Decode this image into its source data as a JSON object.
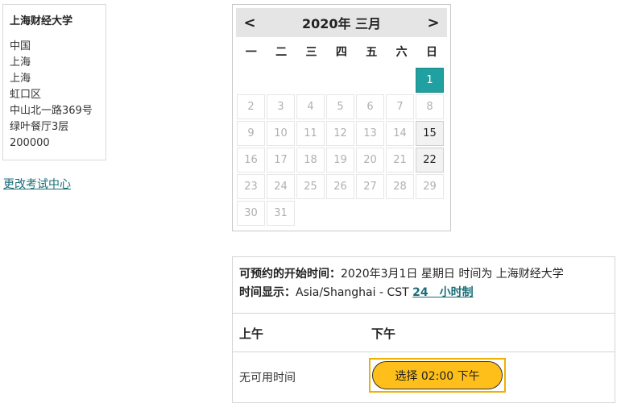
{
  "address": {
    "name": "上海财经大学",
    "lines": [
      "中国",
      "上海",
      "上海",
      "虹口区",
      "中山北一路369号",
      "绿叶餐厅3层",
      "200000"
    ]
  },
  "change_link": "更改考试中心",
  "calendar": {
    "prev": "<",
    "next": ">",
    "title": "2020年 三月",
    "weekdays": [
      "一",
      "二",
      "三",
      "四",
      "五",
      "六",
      "日"
    ],
    "weeks": [
      [
        {
          "d": ""
        },
        {
          "d": ""
        },
        {
          "d": ""
        },
        {
          "d": ""
        },
        {
          "d": ""
        },
        {
          "d": ""
        },
        {
          "d": "1",
          "s": "selected"
        }
      ],
      [
        {
          "d": "2"
        },
        {
          "d": "3"
        },
        {
          "d": "4"
        },
        {
          "d": "5"
        },
        {
          "d": "6"
        },
        {
          "d": "7"
        },
        {
          "d": "8"
        }
      ],
      [
        {
          "d": "9"
        },
        {
          "d": "10"
        },
        {
          "d": "11"
        },
        {
          "d": "12"
        },
        {
          "d": "13"
        },
        {
          "d": "14"
        },
        {
          "d": "15",
          "s": "available"
        }
      ],
      [
        {
          "d": "16"
        },
        {
          "d": "17"
        },
        {
          "d": "18"
        },
        {
          "d": "19"
        },
        {
          "d": "20"
        },
        {
          "d": "21"
        },
        {
          "d": "22",
          "s": "available"
        }
      ],
      [
        {
          "d": "23"
        },
        {
          "d": "24"
        },
        {
          "d": "25"
        },
        {
          "d": "26"
        },
        {
          "d": "27"
        },
        {
          "d": "28"
        },
        {
          "d": "29"
        }
      ],
      [
        {
          "d": "30"
        },
        {
          "d": "31"
        }
      ]
    ]
  },
  "booking": {
    "start_label": "可预约的开始时间：",
    "start_value": "2020年3月1日 星期日 时间为 上海财经大学",
    "tz_label": "时间显示：",
    "tz_value": "Asia/Shanghai - CST",
    "tz_link": "24　小时制",
    "col_am": "上午",
    "col_pm": "下午",
    "am_none": "无可用时间",
    "pm_slot": "选择 02:00 下午"
  }
}
